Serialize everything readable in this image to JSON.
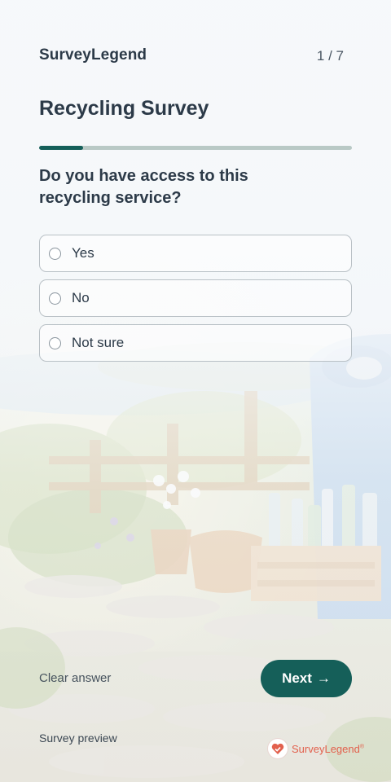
{
  "header": {
    "brand": "SurveyLegend",
    "counter": "1 / 7"
  },
  "survey": {
    "title": "Recycling Survey",
    "progress_fraction": 0.14,
    "question": "Do you have access to this recycling service?",
    "options": [
      {
        "label": "Yes"
      },
      {
        "label": "No"
      },
      {
        "label": "Not sure"
      }
    ]
  },
  "actions": {
    "clear_label": "Clear answer",
    "next_label": "Next",
    "next_icon": "→"
  },
  "footer": {
    "preview_label": "Survey preview",
    "logo_text": "SurveyLegend",
    "logo_mark": "®"
  },
  "colors": {
    "accent": "#155f59",
    "logo": "#e2604d"
  }
}
